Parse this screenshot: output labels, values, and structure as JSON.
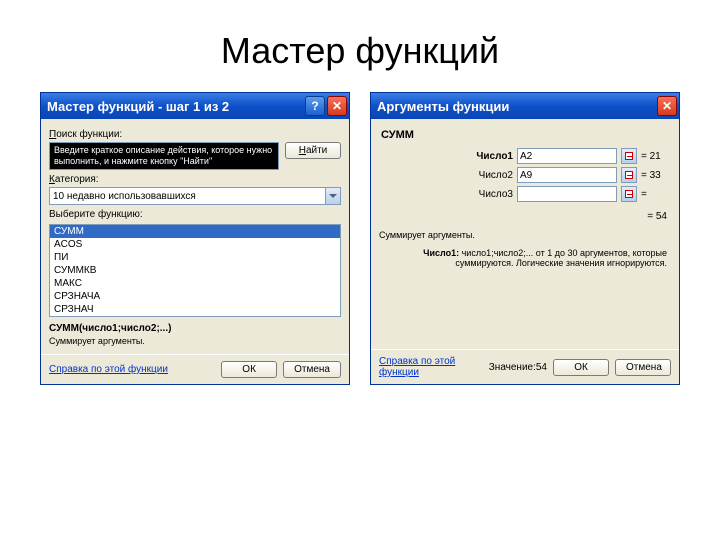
{
  "slide_title": "Мастер функций",
  "dlg1": {
    "title": "Мастер функций - шаг 1 из 2",
    "search_label_prefix": "П",
    "search_label": "оиск функции:",
    "search_hint": "Введите краткое описание действия, которое нужно выполнить, и нажмите кнопку \"Найти\"",
    "find_btn_prefix": "Н",
    "find_btn": "айти",
    "category_label_prefix": "К",
    "category_label": "атегория:",
    "category_value": "10 недавно использовавшихся",
    "select_label": "Выберите функцию:",
    "functions": [
      "СУММ",
      "ACOS",
      "ПИ",
      "СУММКВ",
      "МАКС",
      "СРЗНАЧА",
      "СРЗНАЧ"
    ],
    "signature": "СУММ(число1;число2;...)",
    "description": "Суммирует аргументы.",
    "help_link": "Справка по этой функции",
    "ok": "ОК",
    "cancel": "Отмена"
  },
  "dlg2": {
    "title": "Аргументы функции",
    "func_name": "СУММ",
    "args": [
      {
        "label": "Число1",
        "bold": true,
        "value": "A2",
        "result": "= 21"
      },
      {
        "label": "Число2",
        "bold": false,
        "value": "A9",
        "result": "= 33"
      },
      {
        "label": "Число3",
        "bold": false,
        "value": "",
        "result": "="
      }
    ],
    "result_eq": "= 54",
    "sum_desc": "Суммирует аргументы.",
    "arg_help_label": "Число1:",
    "arg_help_text": "число1;число2;... от 1 до 30 аргументов, которые суммируются. Логические значения игнорируются.",
    "help_link": "Справка по этой функции",
    "value_label": "Значение:54",
    "ok": "ОК",
    "cancel": "Отмена"
  }
}
